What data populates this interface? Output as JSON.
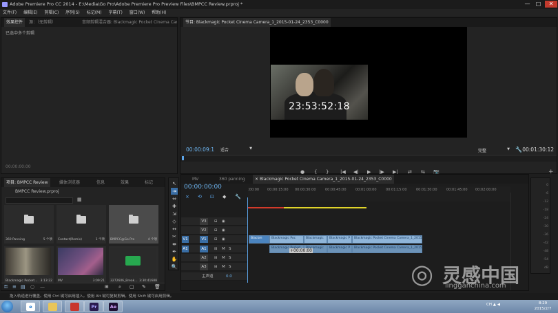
{
  "window": {
    "title": "Adobe Premiere Pro CC 2014 - E:\\Media\\Go Pro\\Adobe Premiere Pro Preview Files\\BMPCC Review.prproj *",
    "min": "—",
    "max": "□",
    "close": "✕"
  },
  "menu": [
    "文件(F)",
    "编辑(E)",
    "剪辑(C)",
    "序列(S)",
    "标记(M)",
    "字幕(T)",
    "窗口(W)",
    "帮助(H)"
  ],
  "source_panel": {
    "tabs": [
      "效果控件",
      "源：（无剪辑）",
      "音频剪辑混合器: Blackmagic Pocket Cinema Camera"
    ],
    "label": "已选中多个剪辑",
    "timecode": "00:00:00:00"
  },
  "program_monitor": {
    "tab": "节目: Blackmagic Pocket Cinema Camera_1_2015-01-24_2353_C0000",
    "overlay_timecode": "23:53:52:18",
    "current_timecode": "00:00:09:1",
    "fit": "适合",
    "quality": "完整",
    "duration": "00:01:30:12",
    "transport": [
      "●",
      "{",
      "}",
      "|◀",
      "◀|",
      "▶",
      "|▶",
      "▶|",
      "⇄",
      "⇆",
      "📷",
      "+"
    ]
  },
  "project_panel": {
    "tabs": [
      "项目: BMPCC Review",
      "媒体浏览器",
      "信息",
      "效果",
      "标记"
    ],
    "file": "BMPCC Review.prproj",
    "bins": [
      {
        "name": "360 Panning",
        "count": "5 个项"
      },
      {
        "name": "Contact(Remix)",
        "count": "1 个项"
      },
      {
        "name": "BMPCC@Go Pro",
        "count": "4 个项"
      }
    ],
    "clips": [
      {
        "name": "Blackmagic Pocket...",
        "duration": "3:13:22"
      },
      {
        "name": "MV",
        "duration": "3:09:21"
      },
      {
        "name": "3272606_Break...",
        "duration": "3:30:41688"
      }
    ],
    "toolbar": [
      "⚿",
      "≡",
      "▤",
      "○",
      "—",
      "⊞",
      "⌕",
      "▢",
      "✎",
      "🗑"
    ]
  },
  "tools": [
    "↖",
    "⇥",
    "⇔",
    "✚",
    "⇲",
    "◇",
    "↔",
    "✂",
    "⇼",
    "✒",
    "✋",
    "🔍"
  ],
  "timeline": {
    "tabs": [
      "MV",
      "360 panning",
      "Blackmagic Pocket Cinema Camera_1_2015-01-24_2353_C0000"
    ],
    "timecode": "00:00:00:00",
    "ruler_ticks": [
      ":00:00",
      "00:00:15:00",
      "00:00:30:00",
      "00:00:45:00",
      "00:01:00:00",
      "00:01:15:00",
      "00:01:30:00",
      "00:01:45:00",
      "00:02:00:00"
    ],
    "video_tracks": [
      {
        "name": "V3",
        "source": ""
      },
      {
        "name": "V2",
        "source": ""
      },
      {
        "name": "V1",
        "source": "V1"
      }
    ],
    "audio_tracks": [
      {
        "name": "A1",
        "source": "A1",
        "m": "M",
        "s": "S"
      },
      {
        "name": "A2",
        "source": "",
        "m": "M",
        "s": "S"
      },
      {
        "name": "A3",
        "source": "",
        "m": "M",
        "s": "S"
      }
    ],
    "master": {
      "label": "主声道",
      "value": "0.0"
    },
    "clips": [
      {
        "label": "Blackm",
        "track": "v1"
      },
      {
        "label": "Blackmagic Poc",
        "track": "v1"
      },
      {
        "label": "Blackmagic",
        "track": "v1"
      },
      {
        "label": "Blackmagic P",
        "track": "v1"
      },
      {
        "label": "Blackmagic Pocket Cinema Camera_1_2015",
        "track": "v1"
      },
      {
        "label": "Blackmagic Pocket",
        "track": "a1"
      },
      {
        "label": "Blackmagic",
        "track": "a1"
      },
      {
        "label": "Blackmagic P",
        "track": "a1"
      },
      {
        "label": "Blackmagic Pocket Cinema Camera_1_2015",
        "track": "a1"
      }
    ],
    "drag_timecode": "+00:00:00"
  },
  "meter": {
    "scale": [
      "0",
      "-6",
      "-12",
      "-18",
      "-24",
      "-30",
      "-36",
      "-42",
      "-48",
      "-54",
      "dB"
    ]
  },
  "status": "拖入轨道进行覆盖。使用 Ctrl 键可启用插入。使用 Alt 键可复制剪辑。使用 Shift 键可启用剪辑。",
  "taskbar": {
    "apps": [
      "e",
      "",
      "",
      "Pr",
      "Ae"
    ],
    "lang": "CH ▲ ◀",
    "time": "8:29",
    "date": "2015/2/7"
  },
  "watermark": {
    "cn": "灵感中国",
    "url": "lingganchina.com"
  },
  "colors": {
    "accent": "#5ca4e8",
    "clip_video": "#4b84bf",
    "clip_audio": "#6c93b8",
    "in_out_red": "#d23a2a",
    "render_yellow": "#e0d42a"
  }
}
